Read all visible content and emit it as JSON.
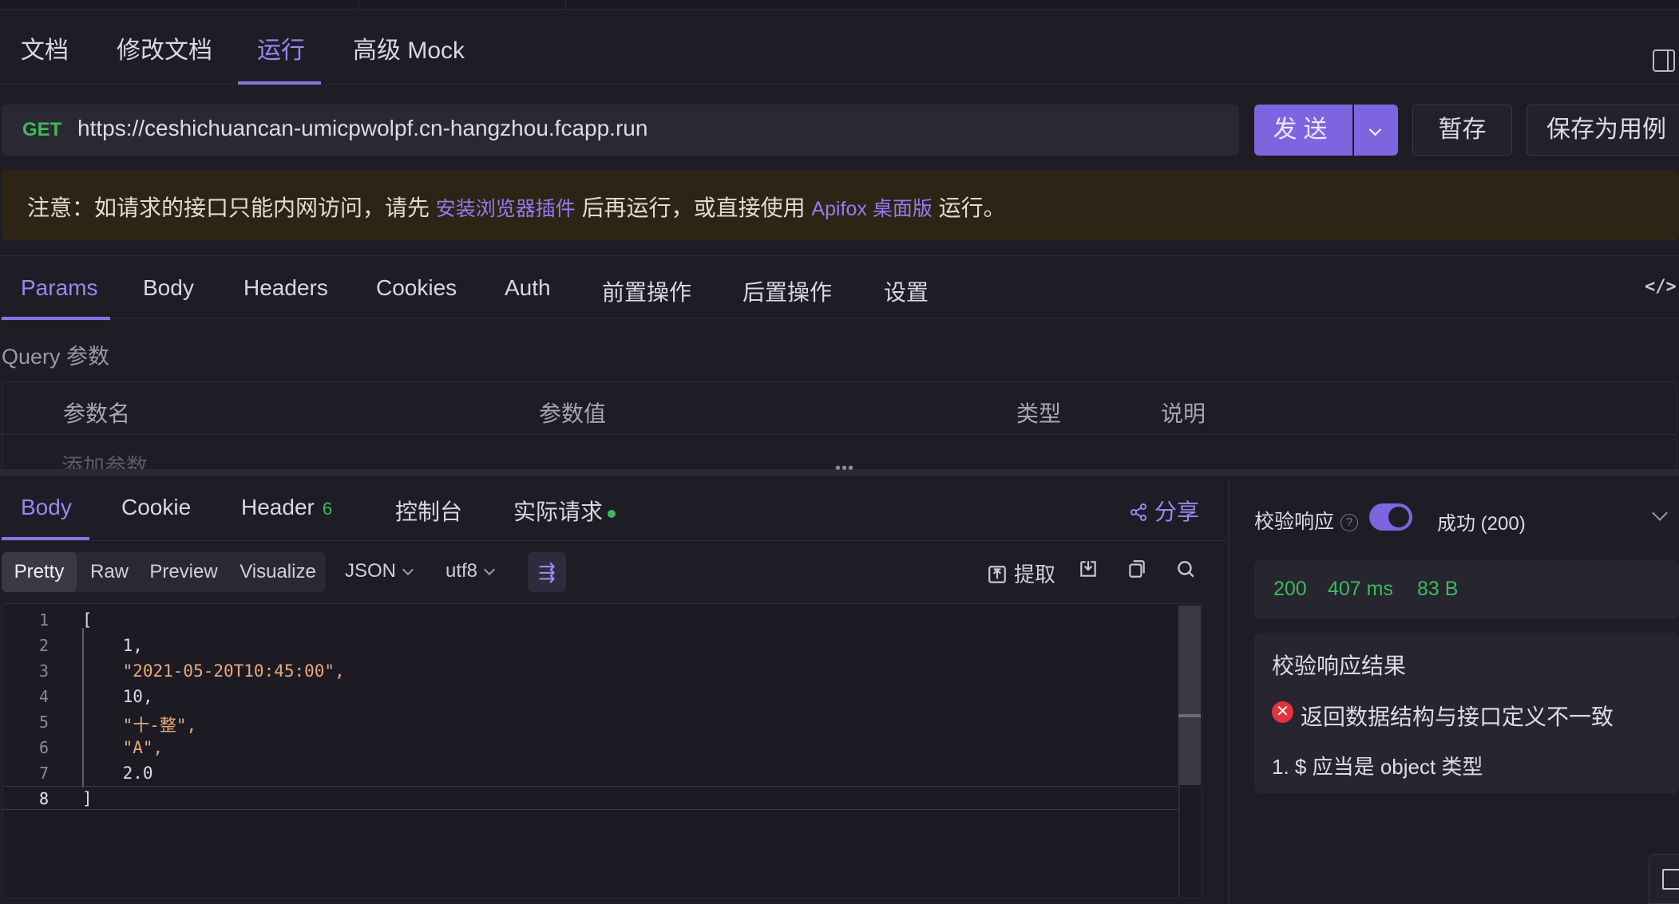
{
  "doc_tabs": [
    "文档",
    "修改文档",
    "运行",
    "高级 Mock"
  ],
  "request": {
    "method": "GET",
    "url": "https://ceshichuancan-umicpwolpf.cn-hangzhou.fcapp.run",
    "send_label": "发送",
    "save_temp_label": "暂存",
    "save_case_label": "保存为用例"
  },
  "warning": {
    "prefix": "注意：如请求的接口只能内网访问，请先",
    "link1": "安装浏览器插件",
    "middle": "后再运行，或直接使用",
    "link2": "Apifox 桌面版",
    "suffix": "运行。"
  },
  "param_tabs": [
    "Params",
    "Body",
    "Headers",
    "Cookies",
    "Auth",
    "前置操作",
    "后置操作",
    "设置"
  ],
  "query": {
    "label": "Query 参数",
    "columns": [
      "参数名",
      "参数值",
      "类型",
      "说明"
    ],
    "add_placeholder": "添加参数"
  },
  "response_tabs": {
    "body": "Body",
    "cookie": "Cookie",
    "header": "Header",
    "header_count": "6",
    "console": "控制台",
    "actual": "实际请求",
    "share": "分享"
  },
  "view_modes": [
    "Pretty",
    "Raw",
    "Preview",
    "Visualize"
  ],
  "format": "JSON",
  "encoding": "utf8",
  "tools": {
    "extract": "提取"
  },
  "code_lines": [
    {
      "n": "1",
      "text": "["
    },
    {
      "n": "2",
      "text": "    1,"
    },
    {
      "n": "3",
      "text": "    \"2021-05-20T10:45:00\","
    },
    {
      "n": "4",
      "text": "    10,"
    },
    {
      "n": "5",
      "text": "    \"十-整\","
    },
    {
      "n": "6",
      "text": "    \"A\","
    },
    {
      "n": "7",
      "text": "    2.0"
    },
    {
      "n": "8",
      "text": "]"
    }
  ],
  "verify": {
    "label": "校验响应",
    "help": "?",
    "status": "成功 (200)",
    "code": "200",
    "time": "407 ms",
    "size": "83 B",
    "result_title": "校验响应结果",
    "error_message": "返回数据结构与接口定义不一致",
    "error_detail": "1. $ 应当是 object 类型"
  },
  "colors": {
    "accent": "#8b72e8",
    "success": "#3dbb5a",
    "error": "#e2333f",
    "string": "#e8a97a"
  }
}
